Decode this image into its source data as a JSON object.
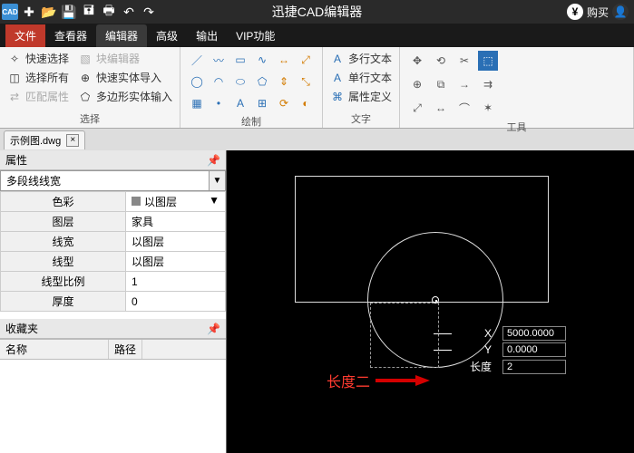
{
  "app_title": "迅捷CAD编辑器",
  "titlebar_right": {
    "buy": "购买"
  },
  "menu": {
    "file": "文件",
    "viewer": "查看器",
    "editor": "编辑器",
    "advanced": "高级",
    "output": "输出",
    "vip": "VIP功能"
  },
  "ribbon": {
    "select_group": {
      "quick_select": "快速选择",
      "select_all": "选择所有",
      "match_props": "匹配属性",
      "block_editor": "块编辑器",
      "quick_entity_import": "快速实体导入",
      "polygon_entity_input": "多边形实体输入",
      "label": "选择"
    },
    "draw_group": {
      "label": "绘制"
    },
    "text_group": {
      "mtext": "多行文本",
      "stext": "单行文本",
      "attdef": "属性定义",
      "label": "文字"
    },
    "tools_group": {
      "label": "工具"
    }
  },
  "doc": {
    "tab_name": "示例图.dwg"
  },
  "props": {
    "panel_title": "属性",
    "dropdown": "多段线线宽",
    "rows": {
      "color_k": "色彩",
      "color_v": "以图层",
      "layer_k": "图层",
      "layer_v": "家具",
      "lw_k": "线宽",
      "lw_v": "以图层",
      "lt_k": "线型",
      "lt_v": "以图层",
      "lts_k": "线型比例",
      "lts_v": "1",
      "thick_k": "厚度",
      "thick_v": "0"
    }
  },
  "fav": {
    "title": "收藏夹",
    "col_name": "名称",
    "col_path": "路径"
  },
  "coords": {
    "x_label": "X",
    "x_val": "5000.0000",
    "y_label": "Y",
    "y_val": "0.0000",
    "len_label": "长度",
    "len_val": "2"
  },
  "annotation": "长度二"
}
